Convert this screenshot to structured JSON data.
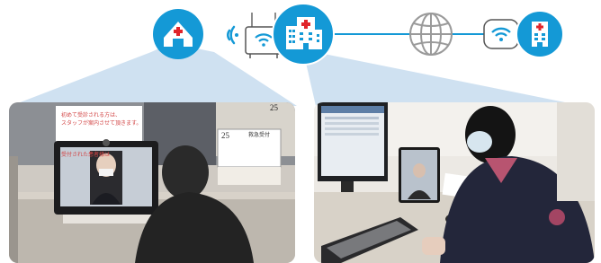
{
  "icons": {
    "home_clinic": "home-with-red-cross-icon",
    "wireless_waves": "wifi-signal-waves-icon",
    "access_point": "wifi-access-point-router-icon",
    "hospital_main": "hospital-building-icon",
    "internet": "globe-icon",
    "remote_wifi": "wifi-icon",
    "hospital_remote": "hospital-building-icon"
  },
  "colors": {
    "accent_blue": "#1499d6",
    "light_blue_beam": "#c7dcef",
    "red_cross": "#e0242a",
    "globe_gray": "#9a9a9a"
  },
  "photos": {
    "left": {
      "sign_line1": "初めて受診される方は、",
      "sign_line2": "スタッフが案内させて頂きます。",
      "sign_line3": "受付された患者様は",
      "counter_number_top": "25",
      "counter_number": "25",
      "desk_label": "救急受付"
    }
  }
}
